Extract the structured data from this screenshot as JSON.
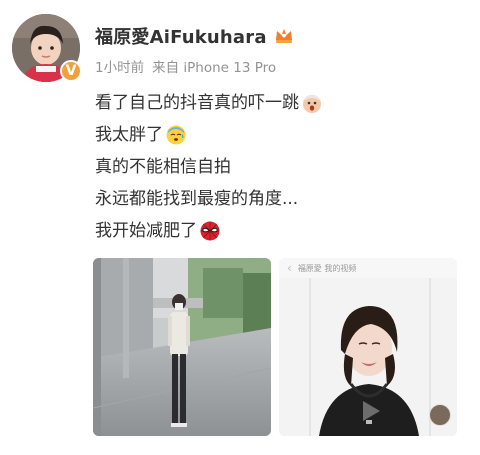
{
  "post": {
    "username": "福原愛AiFukuhara",
    "time": "1小时前",
    "source": "来自 iPhone 13 Pro",
    "verified_badge": "V",
    "lines": [
      "看了自己的抖音真的吓一跳",
      "我太胖了",
      "真的不能相信自拍",
      "永远都能找到最瘦的角度...",
      "我开始减肥了"
    ],
    "icons": {
      "crown": "crown-icon",
      "line1": "shocked-face-emoji",
      "line2": "cold-sweat-face-emoji",
      "line5": "spider-man-emoji"
    }
  },
  "media": {
    "video_topbar_text": "福原愛 我的视频"
  }
}
